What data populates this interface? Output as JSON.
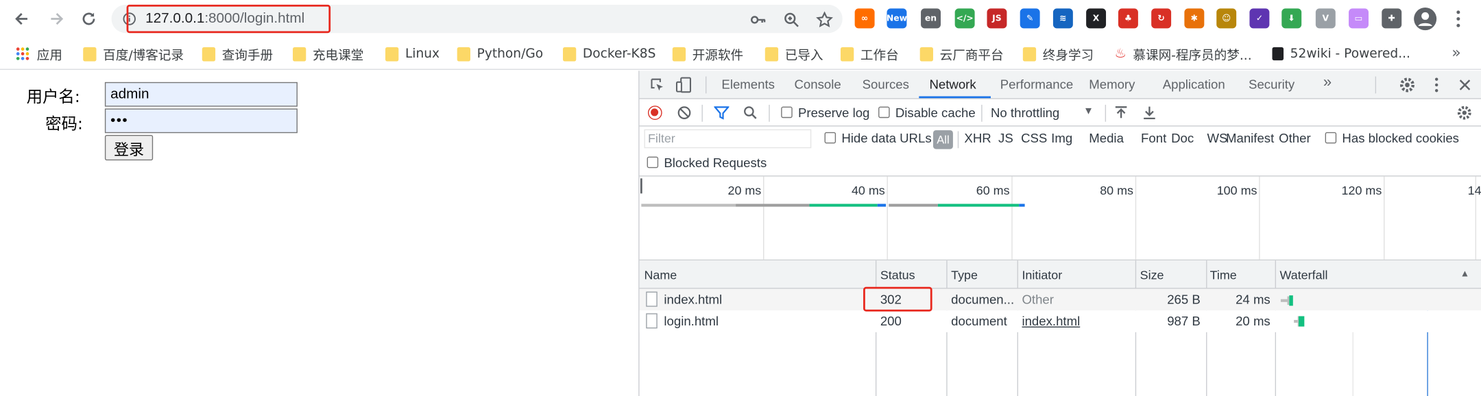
{
  "browser": {
    "url_host": "127.0.0.1",
    "url_rest": ":8000/login.html",
    "extensions": [
      {
        "icon": "infinity-extension-icon",
        "color": "#ff6d00",
        "glyph": "∞"
      },
      {
        "icon": "new-extension-icon",
        "color": "#1a73e8",
        "glyph": "New"
      },
      {
        "icon": "translate-extension-icon",
        "color": "#5f6368",
        "glyph": "en"
      },
      {
        "icon": "code-extension-icon",
        "color": "#34a853",
        "glyph": "</>"
      },
      {
        "icon": "js-extension-icon",
        "color": "#c62828",
        "glyph": "JS"
      },
      {
        "icon": "pen-extension-icon",
        "color": "#1a73e8",
        "glyph": "✎"
      },
      {
        "icon": "layers-extension-icon",
        "color": "#1565c0",
        "glyph": "≋"
      },
      {
        "icon": "x-extension-icon",
        "color": "#202124",
        "glyph": "X"
      },
      {
        "icon": "network-extension-icon",
        "color": "#d93025",
        "glyph": "♣"
      },
      {
        "icon": "refresh-extension-icon",
        "color": "#d93025",
        "glyph": "↻"
      },
      {
        "icon": "pinwheel-extension-icon",
        "color": "#e8710a",
        "glyph": "✱"
      },
      {
        "icon": "face-extension-icon",
        "color": "#b8860b",
        "glyph": "☺"
      },
      {
        "icon": "check-extension-icon",
        "color": "#5e35b1",
        "glyph": "✓"
      },
      {
        "icon": "download-extension-icon",
        "color": "#34a853",
        "glyph": "⬇"
      },
      {
        "icon": "vue-extension-icon",
        "color": "#9aa0a6",
        "glyph": "V"
      },
      {
        "icon": "screen-extension-icon",
        "color": "#c58af9",
        "glyph": "▭"
      },
      {
        "icon": "puzzle-extension-icon",
        "color": "#5f6368",
        "glyph": "✚"
      }
    ]
  },
  "bookmarks": {
    "apps_label": "应用",
    "items": [
      "百度/博客记录",
      "查询手册",
      "充电课堂",
      "Linux",
      "Python/Go",
      "Docker-K8S",
      "开源软件",
      "已导入",
      "工作台",
      "云厂商平台",
      "终身学习",
      "慕课网-程序员的梦...",
      "52wiki - Powered..."
    ],
    "more": "»"
  },
  "login": {
    "username_label": "用户名:",
    "username_value": "admin",
    "password_label": "密码:",
    "password_value": "•••",
    "submit_label": "登录"
  },
  "devtools": {
    "tabs": [
      "Elements",
      "Console",
      "Sources",
      "Network",
      "Performance",
      "Memory",
      "Application",
      "Security"
    ],
    "active_tab": "Network",
    "more_tabs": "»",
    "preserve_log": "Preserve log",
    "disable_cache": "Disable cache",
    "throttling": "No throttling",
    "filter_placeholder": "Filter",
    "hide_data_urls": "Hide data URLs",
    "type_filters": [
      "All",
      "XHR",
      "JS",
      "CSS",
      "Img",
      "Media",
      "Font",
      "Doc",
      "WS",
      "Manifest",
      "Other"
    ],
    "has_blocked_cookies": "Has blocked cookies",
    "blocked_requests": "Blocked Requests",
    "timeline_ticks": [
      "20 ms",
      "40 ms",
      "60 ms",
      "80 ms",
      "100 ms",
      "120 ms",
      "14"
    ],
    "columns": [
      "Name",
      "Status",
      "Type",
      "Initiator",
      "Size",
      "Time",
      "Waterfall"
    ],
    "rows": [
      {
        "name": "index.html",
        "status": "302",
        "type": "documen...",
        "initiator": "Other",
        "size": "265 B",
        "time": "24 ms"
      },
      {
        "name": "login.html",
        "status": "200",
        "type": "document",
        "initiator": "index.html",
        "size": "987 B",
        "time": "20 ms"
      }
    ],
    "accent": "#1a73e8",
    "highlight": "#e8271d"
  }
}
